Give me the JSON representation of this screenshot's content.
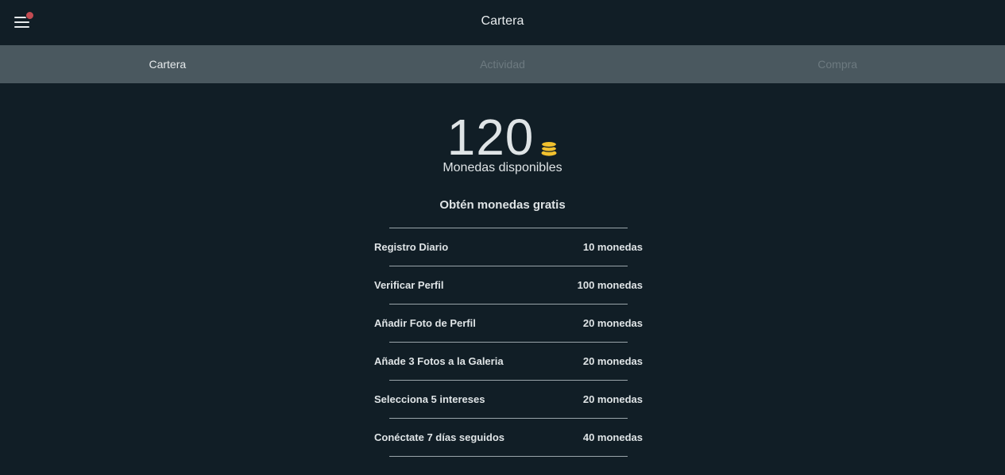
{
  "header": {
    "title": "Cartera"
  },
  "tabs": [
    {
      "label": "Cartera",
      "active": true
    },
    {
      "label": "Actividad",
      "active": false
    },
    {
      "label": "Compra",
      "active": false
    }
  ],
  "wallet": {
    "balance": "120",
    "balance_caption": "Monedas disponibles",
    "coin_color": "#f2c12e"
  },
  "free_coins": {
    "title": "Obtén monedas gratis",
    "items": [
      {
        "label": "Registro Diario",
        "reward": "10 monedas"
      },
      {
        "label": "Verificar Perfil",
        "reward": "100 monedas"
      },
      {
        "label": "Añadir Foto de Perfil",
        "reward": "20 monedas"
      },
      {
        "label": "Añade 3 Fotos a la Galeria",
        "reward": "20 monedas"
      },
      {
        "label": "Selecciona 5 intereses",
        "reward": "20 monedas"
      },
      {
        "label": "Conéctate 7 días seguidos",
        "reward": "40 monedas"
      }
    ]
  },
  "colors": {
    "background": "#111e26",
    "tab_bar": "#4a585f",
    "notification_dot": "#c34b52"
  }
}
